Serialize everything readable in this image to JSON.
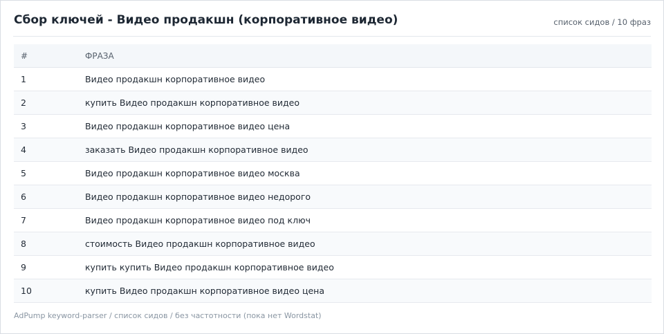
{
  "header": {
    "title": "Сбор ключей - Видео продакшн (корпоративное видео)",
    "meta": "список сидов / 10 фраз"
  },
  "table": {
    "columns": [
      "#",
      "ФРАЗА"
    ],
    "rows": [
      {
        "num": "1",
        "phrase": "Видео продакшн корпоративное видео"
      },
      {
        "num": "2",
        "phrase": "купить Видео продакшн корпоративное видео"
      },
      {
        "num": "3",
        "phrase": "Видео продакшн корпоративное видео цена"
      },
      {
        "num": "4",
        "phrase": "заказать Видео продакшн корпоративное видео"
      },
      {
        "num": "5",
        "phrase": "Видео продакшн корпоративное видео москва"
      },
      {
        "num": "6",
        "phrase": "Видео продакшн корпоративное видео недорого"
      },
      {
        "num": "7",
        "phrase": "Видео продакшн корпоративное видео под ключ"
      },
      {
        "num": "8",
        "phrase": "стоимость Видео продакшн корпоративное видео"
      },
      {
        "num": "9",
        "phrase": "купить купить Видео продакшн корпоративное видео"
      },
      {
        "num": "10",
        "phrase": "купить Видео продакшн корпоративное видео цена"
      }
    ]
  },
  "footer": {
    "text": "AdPump keyword-parser / список сидов / без частотности (пока нет Wordstat)"
  }
}
